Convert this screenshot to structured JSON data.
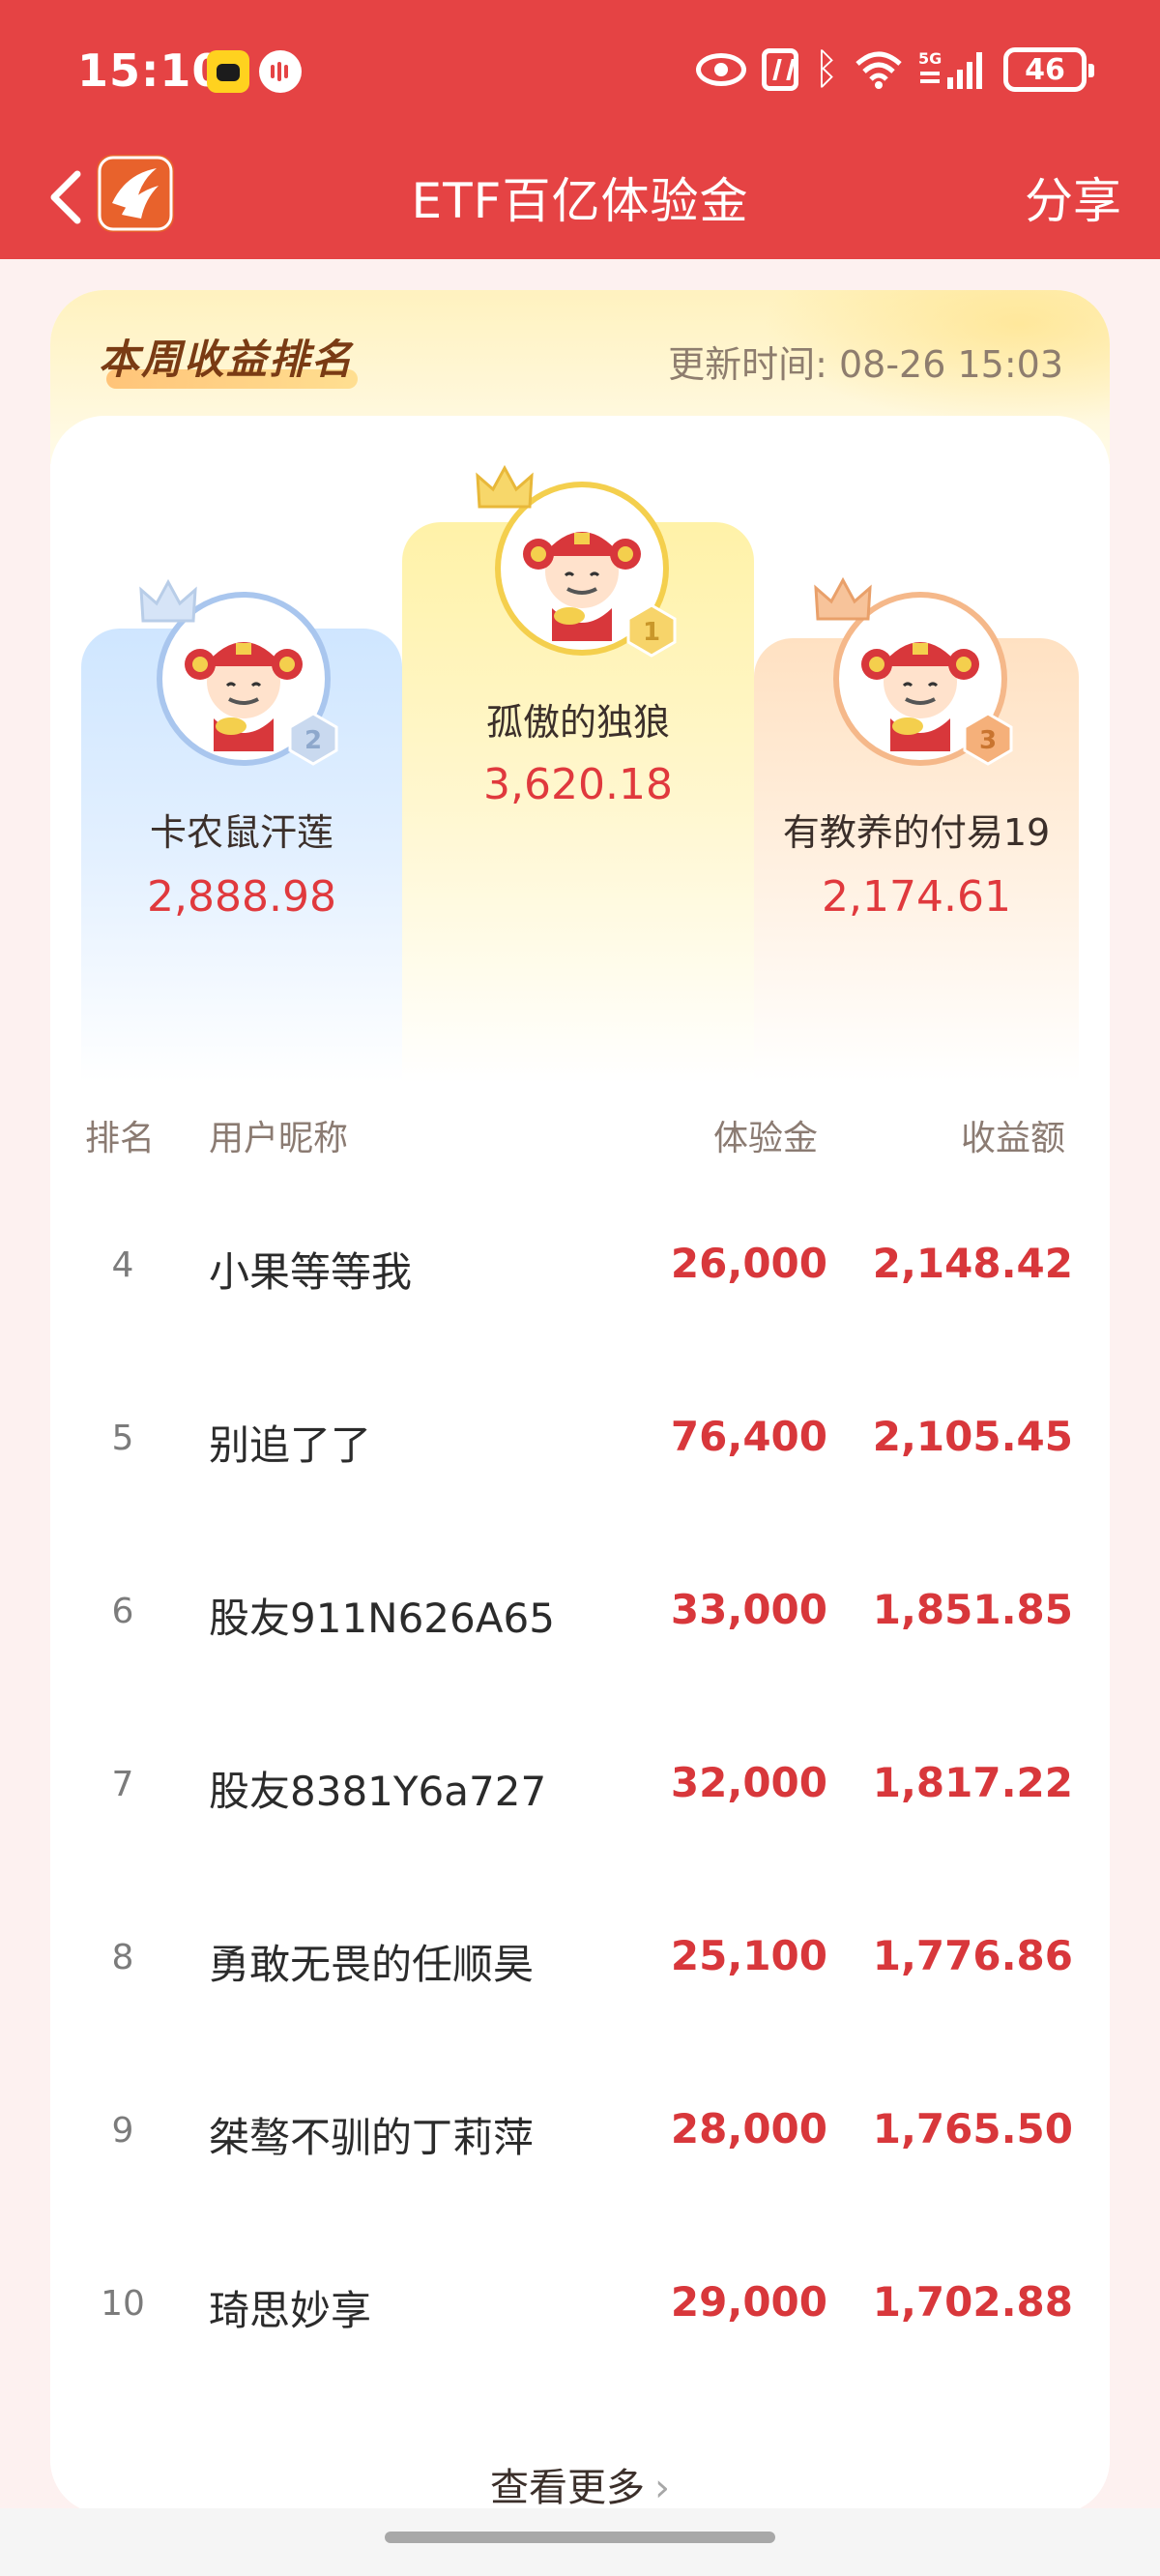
{
  "status_bar": {
    "time": "15:10",
    "network": "5G",
    "battery": "46",
    "icons": [
      "app-badge-icon",
      "voice-icon",
      "eye-icon",
      "nfc-icon",
      "bluetooth-icon",
      "wifi-icon",
      "signal-icon",
      "battery-icon"
    ]
  },
  "header": {
    "title": "ETF百亿体验金",
    "share_label": "分享",
    "back_icon": "chevron-left-icon",
    "logo_icon": "app-logo-icon"
  },
  "ranking": {
    "title": "本周收益排名",
    "update_time": "更新时间: 08-26 15:03",
    "podium": [
      {
        "rank": "1",
        "name": "孤傲的独狼",
        "value": "3,620.18"
      },
      {
        "rank": "2",
        "name": "卡农鼠汗莲",
        "value": "2,888.98"
      },
      {
        "rank": "3",
        "name": "有教养的付易19",
        "value": "2,174.61"
      }
    ],
    "columns": {
      "rank": "排名",
      "name": "用户昵称",
      "experience": "体验金",
      "profit": "收益额"
    },
    "rows": [
      {
        "rank": "4",
        "name": "小果等等我",
        "experience": "26,000",
        "profit": "2,148.42"
      },
      {
        "rank": "5",
        "name": "别追了了",
        "experience": "76,400",
        "profit": "2,105.45"
      },
      {
        "rank": "6",
        "name": "股友911N626A65",
        "experience": "33,000",
        "profit": "1,851.85"
      },
      {
        "rank": "7",
        "name": "股友8381Y6a727",
        "experience": "32,000",
        "profit": "1,817.22"
      },
      {
        "rank": "8",
        "name": "勇敢无畏的任顺昊",
        "experience": "25,100",
        "profit": "1,776.86"
      },
      {
        "rank": "9",
        "name": "桀骜不驯的丁莉萍",
        "experience": "28,000",
        "profit": "1,765.50"
      },
      {
        "rank": "10",
        "name": "琦思妙享",
        "experience": "29,000",
        "profit": "1,702.88"
      }
    ],
    "more_label": "查看更多",
    "more_chevron": "›"
  },
  "colors": {
    "header_red": "#e54344",
    "value_red": "#d8373b",
    "gold": "#f4cf4d",
    "silver": "#a9c6ee",
    "bronze": "#f5b88a"
  }
}
